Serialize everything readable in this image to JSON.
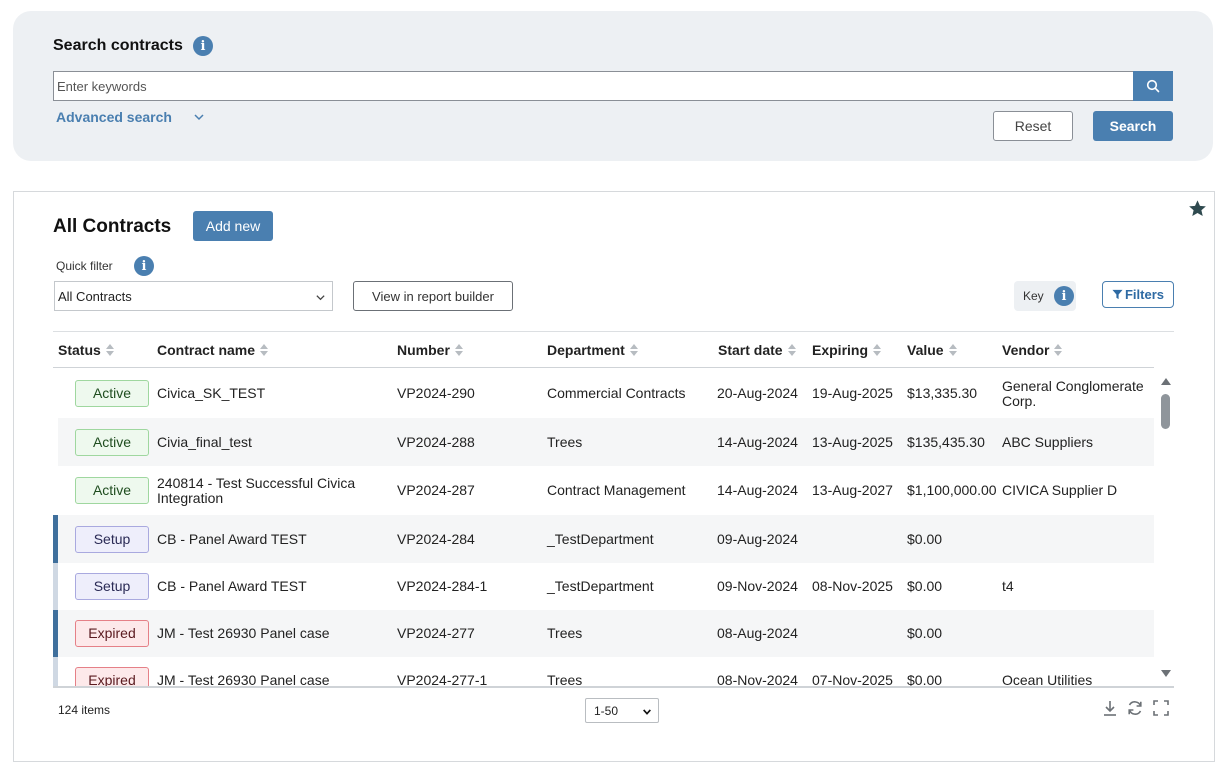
{
  "search": {
    "title": "Search contracts",
    "placeholder": "Enter keywords",
    "advanced_label": "Advanced search",
    "reset_label": "Reset",
    "search_label": "Search"
  },
  "contracts": {
    "title": "All Contracts",
    "add_new_label": "Add new",
    "quick_filter_label": "Quick filter",
    "quick_filter_value": "All Contracts",
    "report_builder_label": "View in report builder",
    "key_label": "Key",
    "filters_label": "Filters",
    "columns": {
      "status": "Status",
      "name": "Contract name",
      "number": "Number",
      "department": "Department",
      "start": "Start date",
      "expiring": "Expiring",
      "value": "Value",
      "vendor": "Vendor"
    },
    "rows": [
      {
        "status": "Active",
        "name": "Civica_SK_TEST",
        "number": "VP2024-290",
        "department": "Commercial Contracts",
        "start": "20-Aug-2024",
        "expiring": "19-Aug-2025",
        "value": "$13,335.30",
        "vendor": "General Conglomerate Corp."
      },
      {
        "status": "Active",
        "name": "Civia_final_test",
        "number": "VP2024-288",
        "department": "Trees",
        "start": "14-Aug-2024",
        "expiring": "13-Aug-2025",
        "value": "$135,435.30",
        "vendor": "ABC Suppliers"
      },
      {
        "status": "Active",
        "name": "240814 - Test Successful Civica Integration",
        "number": "VP2024-287",
        "department": "Contract Management",
        "start": "14-Aug-2024",
        "expiring": "13-Aug-2027",
        "value": "$1,100,000.00",
        "vendor": "CIVICA Supplier D"
      },
      {
        "status": "Setup",
        "name": "CB - Panel Award TEST",
        "number": "VP2024-284",
        "department": "_TestDepartment",
        "start": "09-Aug-2024",
        "expiring": "",
        "value": "$0.00",
        "vendor": ""
      },
      {
        "status": "Setup",
        "name": "CB - Panel Award TEST",
        "number": "VP2024-284-1",
        "department": "_TestDepartment",
        "start": "09-Nov-2024",
        "expiring": "08-Nov-2025",
        "value": "$0.00",
        "vendor": "t4"
      },
      {
        "status": "Expired",
        "name": "JM - Test 26930 Panel case",
        "number": "VP2024-277",
        "department": "Trees",
        "start": "08-Aug-2024",
        "expiring": "",
        "value": "$0.00",
        "vendor": ""
      },
      {
        "status": "Expired",
        "name": "JM - Test 26930 Panel case",
        "number": "VP2024-277-1",
        "department": "Trees",
        "start": "08-Nov-2024",
        "expiring": "07-Nov-2025",
        "value": "$0.00",
        "vendor": "Ocean Utilities"
      }
    ],
    "items_count": "124 items",
    "page_size": "1-50"
  },
  "colors": {
    "accent": "#4a7fb0",
    "panel_bg": "#edf0f3",
    "parent_marker": "#3f6f9c",
    "child_marker": "#cfd8e3"
  }
}
